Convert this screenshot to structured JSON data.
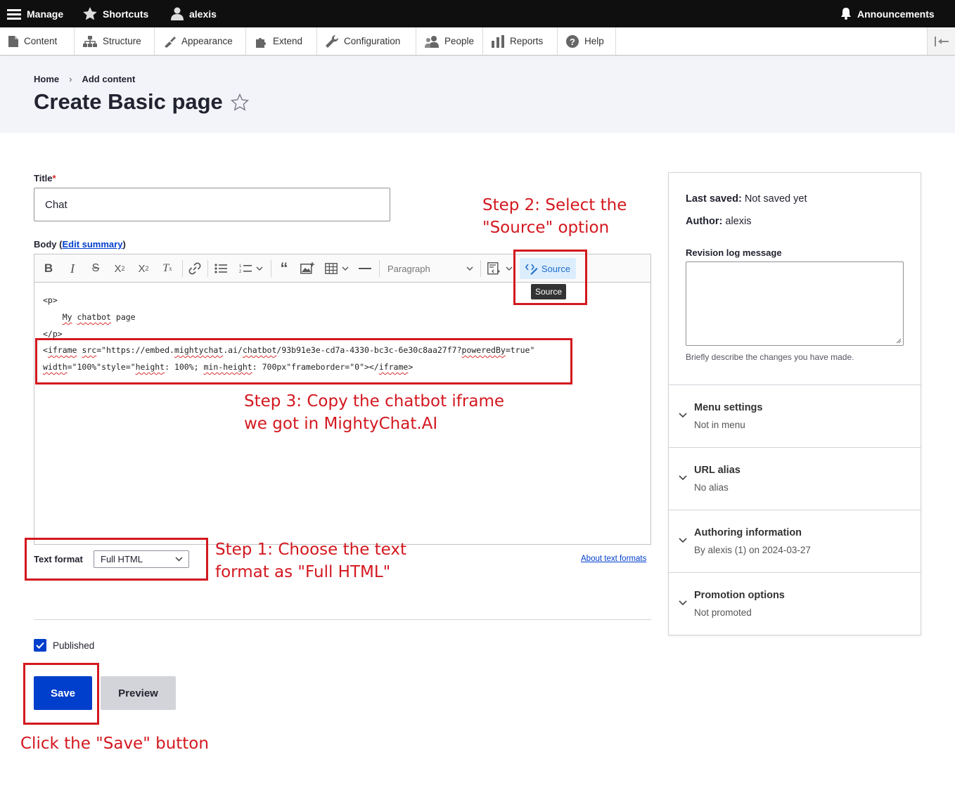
{
  "topbar": {
    "manage": "Manage",
    "shortcuts": "Shortcuts",
    "user": "alexis",
    "announcements": "Announcements"
  },
  "tray": {
    "items": [
      "Content",
      "Structure",
      "Appearance",
      "Extend",
      "Configuration",
      "People",
      "Reports",
      "Help"
    ]
  },
  "breadcrumb": {
    "home": "Home",
    "sep": "›",
    "current": "Add content"
  },
  "page": {
    "title": "Create Basic page",
    "star": "☆"
  },
  "form": {
    "title_label": "Title",
    "required_mark": "*",
    "title_value": "Chat",
    "body_label": "Body",
    "edit_summary_open": "(",
    "edit_summary": "Edit summary",
    "edit_summary_close": ")"
  },
  "editor": {
    "paragraph_select": "Paragraph",
    "source_label": "Source",
    "tooltip": "Source",
    "code_lines": {
      "l1": "<p>",
      "l2a": "    ",
      "l2_my": "My",
      "l2_sp1": " ",
      "l2_chatbot": "chatbot",
      "l2_rest": " page",
      "l3": "</p>",
      "l4a": "<",
      "l4_iframe": "iframe",
      "l4_sp": " ",
      "l4_src": "src",
      "l4_b": "=\"https://embed.",
      "l4_mighty": "mightychat",
      "l4_c": ".ai/",
      "l4_chatbot": "chatbot",
      "l4_d": "/93b91e3e-cd7a-4330-bc3c-6e30c8aa27f7?",
      "l4_powered": "poweredBy",
      "l4_e": "=true\"",
      "l5_width": "width",
      "l5_a": "=\"100%\"style=\"",
      "l5_height": "height",
      "l5_b": ": 100%; ",
      "l5_min": "min-height",
      "l5_c": ": 700px\"frameborder=\"0\"></",
      "l5_iframe": "iframe",
      "l5_d": ">"
    }
  },
  "text_format": {
    "label": "Text format",
    "value": "Full HTML",
    "about": "About text formats"
  },
  "published": {
    "label": "Published"
  },
  "buttons": {
    "save": "Save",
    "preview": "Preview"
  },
  "sidebar": {
    "last_saved_label": "Last saved:",
    "last_saved_value": "Not saved yet",
    "author_label": "Author:",
    "author_value": "alexis",
    "revision_label": "Revision log message",
    "revision_help": "Briefly describe the changes you have made.",
    "sections": [
      {
        "title": "Menu settings",
        "summary": "Not in menu"
      },
      {
        "title": "URL alias",
        "summary": "No alias"
      },
      {
        "title": "Authoring information",
        "summary": "By alexis (1) on 2024-03-27"
      },
      {
        "title": "Promotion options",
        "summary": "Not promoted"
      }
    ]
  },
  "annotations": {
    "step2_line1": "Step 2: Select the",
    "step2_line2": "\"Source\" option",
    "step3_line1": "Step 3: Copy the chatbot iframe",
    "step3_line2": "we got in MightyChat.AI",
    "step1_line1": "Step 1: Choose the text",
    "step1_line2": "format as \"Full HTML\"",
    "save_note": "Click the \"Save\" button"
  },
  "colors": {
    "annotation": "#d3181f",
    "primary": "#003ecc",
    "topbar": "#0f0f0f"
  }
}
